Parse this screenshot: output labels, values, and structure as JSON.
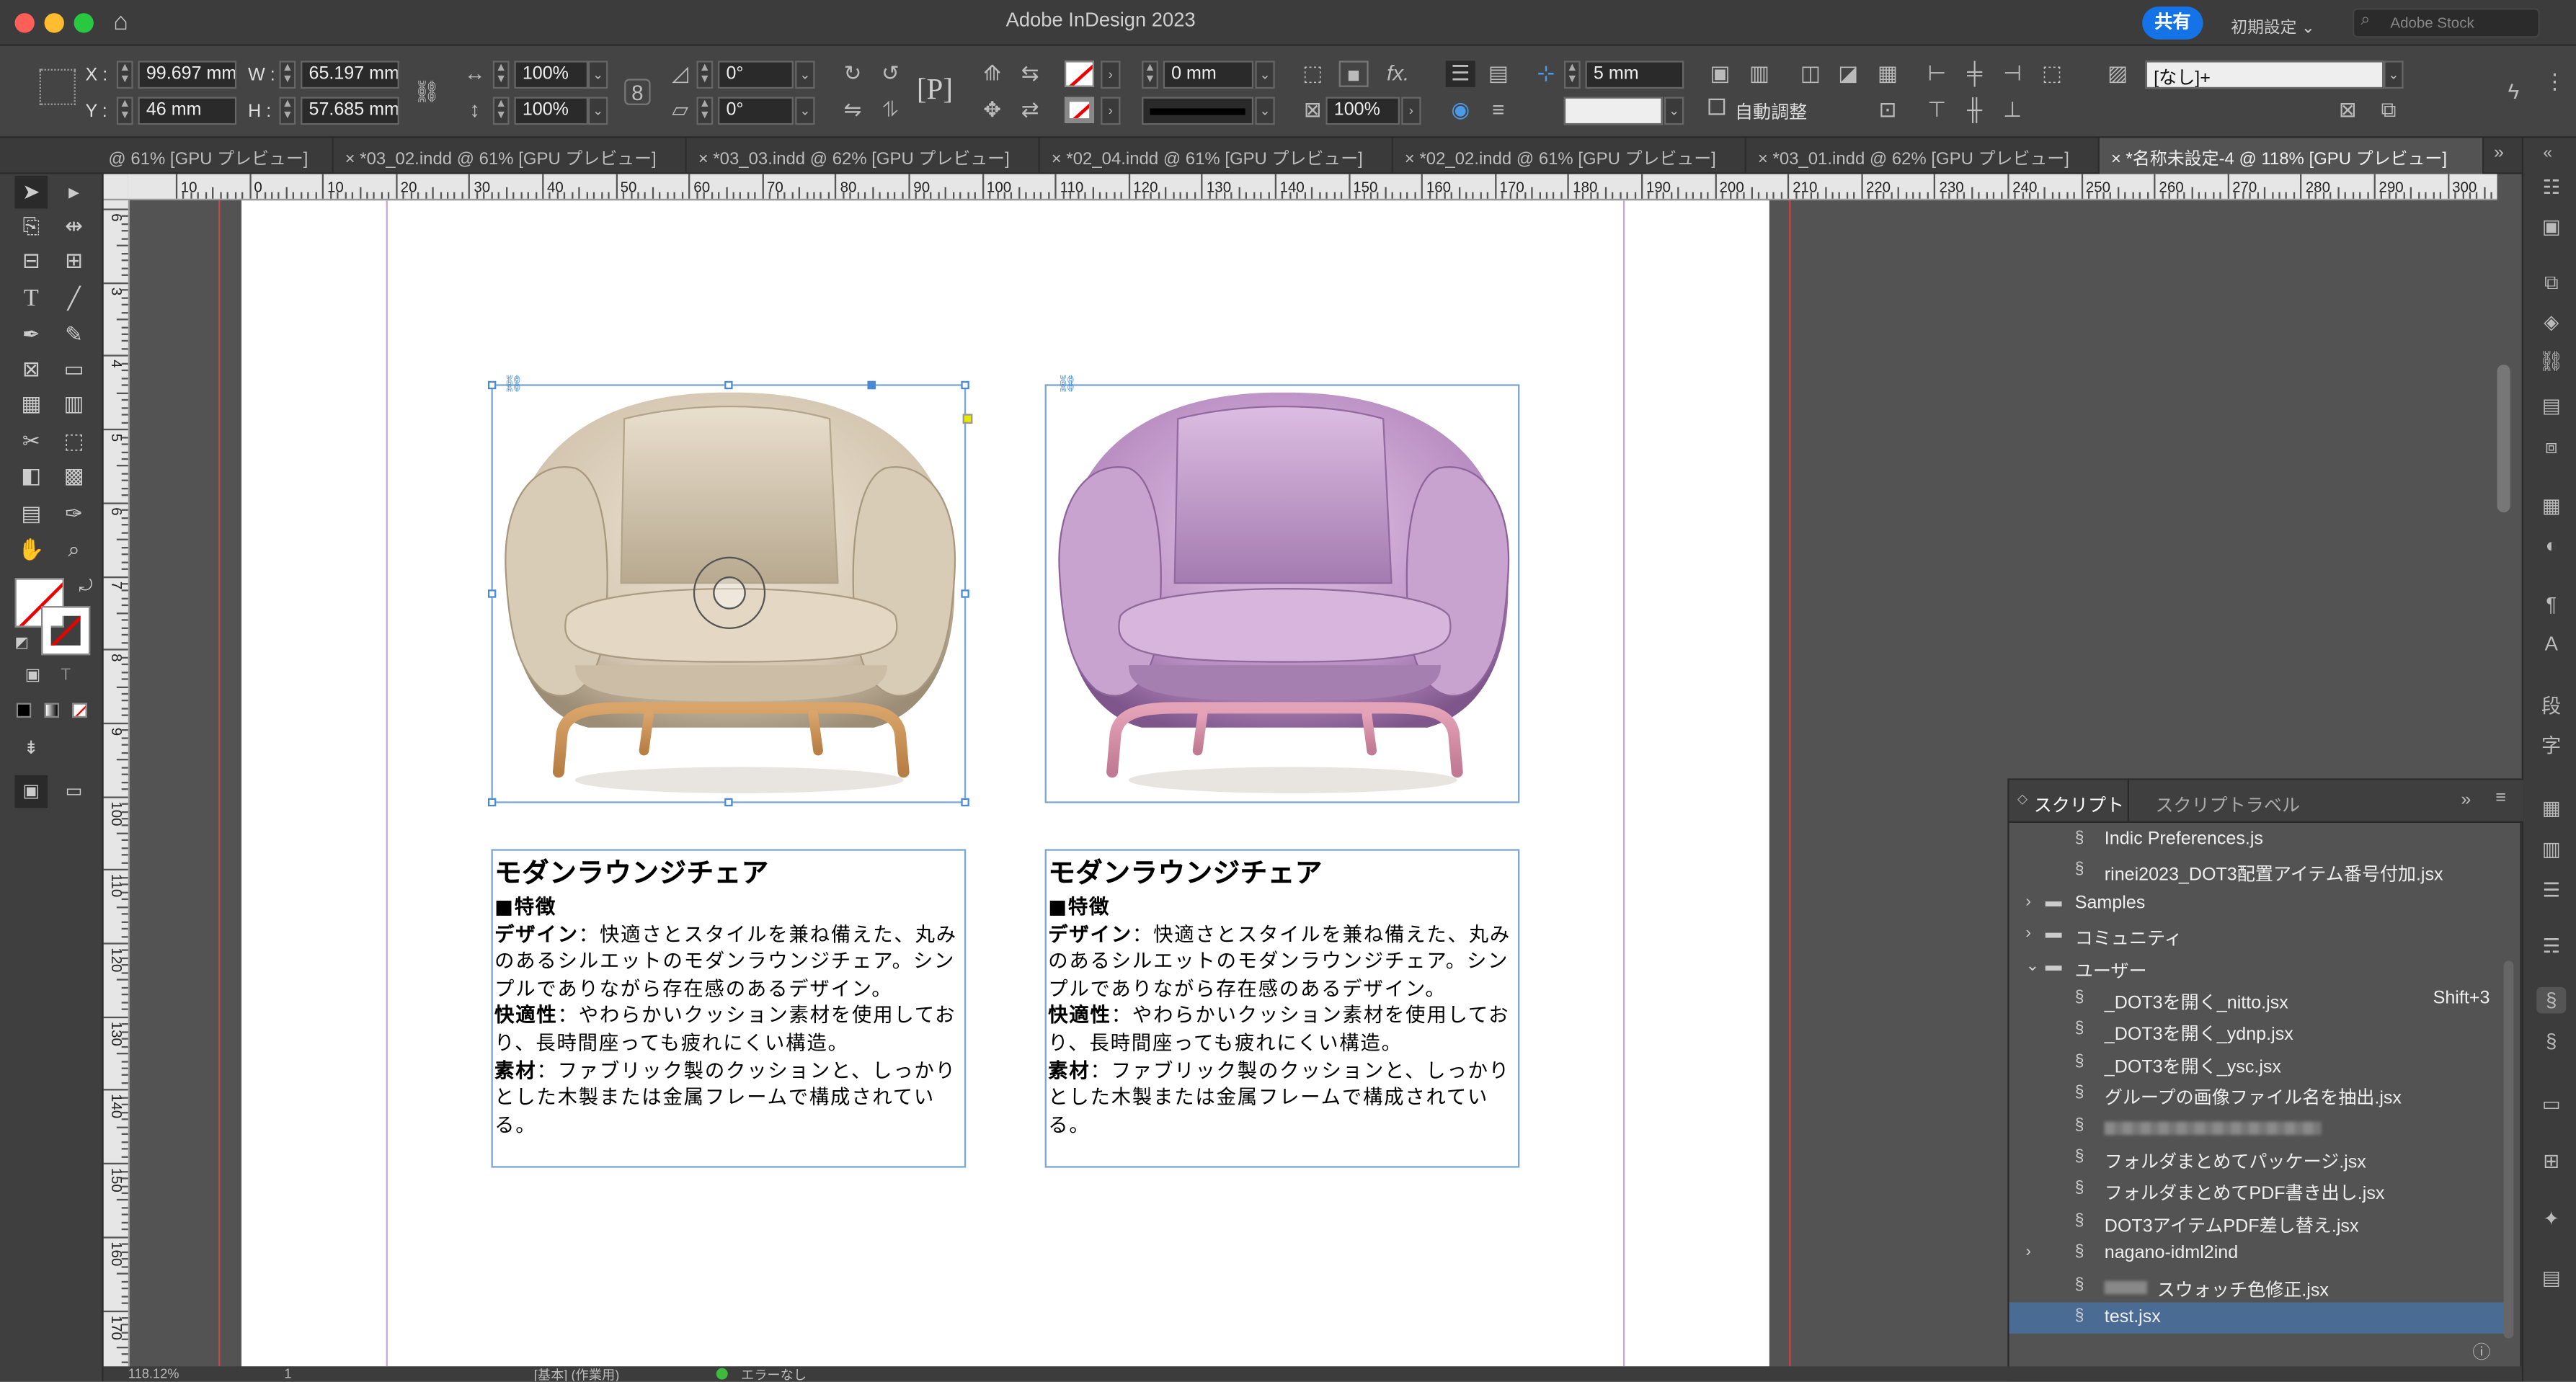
{
  "app": {
    "title": "Adobe InDesign 2023",
    "share_label": "共有",
    "workspace": "初期設定",
    "stock_placeholder": "Adobe Stock"
  },
  "control": {
    "x_label": "X :",
    "x": "99.697 mm",
    "y_label": "Y :",
    "y": "46 mm",
    "w_label": "W :",
    "w": "65.197 mm",
    "h_label": "H :",
    "h": "57.685 mm",
    "scale_x": "100%",
    "scale_y": "100%",
    "rotate": "0°",
    "shear": "0°",
    "stroke_weight": "0 mm",
    "opacity": "100%",
    "gap": "5 mm",
    "auto_fit": "自動調整",
    "object_style": "[なし]+"
  },
  "tabs": [
    {
      "label": "@ 61% [GPU プレビュー]"
    },
    {
      "label": "*03_02.indd @ 61% [GPU プレビュー]"
    },
    {
      "label": "*03_03.indd @ 62% [GPU プレビュー]"
    },
    {
      "label": "*02_04.indd @ 61% [GPU プレビュー]"
    },
    {
      "label": "*02_02.indd @ 61% [GPU プレビュー]"
    },
    {
      "label": "*03_01.indd @ 62% [GPU プレビュー]"
    },
    {
      "label": "*名称未設定-4 @ 118% [GPU プレビュー]"
    }
  ],
  "hruler": [
    "10",
    "0",
    "10",
    "20",
    "30",
    "40",
    "50",
    "60",
    "70",
    "80",
    "90",
    "100",
    "110",
    "120",
    "130",
    "140",
    "150",
    "160",
    "170",
    "180",
    "190",
    "200",
    "210",
    "220",
    "230",
    "240",
    "250",
    "260",
    "270",
    "280",
    "290",
    "300"
  ],
  "vruler": [
    "6",
    "3",
    "4",
    "5",
    "6",
    "7",
    "8",
    "9",
    "100",
    "110",
    "120",
    "130",
    "140",
    "150",
    "160",
    "170"
  ],
  "cards": [
    {
      "title": "モダンラウンジチェア",
      "feature": "■特徴",
      "design_label": "デザイン",
      "design_text": "：快適さとスタイルを兼ね備えた、丸みのあるシルエットのモダンラウンジチェア。シンプルでありながら存在感のあるデザイン。",
      "comfort_label": "快適性",
      "comfort_text": "：やわらかいクッション素材を使用しており、長時間座っても疲れにくい構造。",
      "material_label": "素材",
      "material_text": "：ファブリック製のクッションと、しっかりとした木製または金属フレームで構成されている。",
      "color": "beige"
    },
    {
      "title": "モダンラウンジチェア",
      "feature": "■特徴",
      "design_label": "デザイン",
      "design_text": "：快適さとスタイルを兼ね備えた、丸みのあるシルエットのモダンラウンジチェア。シンプルでありながら存在感のあるデザイン。",
      "comfort_label": "快適性",
      "comfort_text": "：やわらかいクッション素材を使用しており、長時間座っても疲れにくい構造。",
      "material_label": "素材",
      "material_text": "：ファブリック製のクッションと、しっかりとした木製または金属フレームで構成されている。",
      "color": "purple"
    }
  ],
  "scripts_panel": {
    "tab_scripts": "スクリプト",
    "tab_labels": "スクリプトラベル",
    "items": [
      {
        "label": "Indic Preferences.js",
        "type": "script"
      },
      {
        "label": "rinei2023_DOT3配置アイテム番号付加.jsx",
        "type": "script"
      },
      {
        "label": "Samples",
        "type": "folder"
      },
      {
        "label": "コミュニティ",
        "type": "folder"
      },
      {
        "label": "ユーザー",
        "type": "folder-open"
      },
      {
        "label": "_DOT3を開く_nitto.jsx",
        "type": "script",
        "shortcut": "Shift+3"
      },
      {
        "label": "_DOT3を開く_ydnp.jsx",
        "type": "script"
      },
      {
        "label": "_DOT3を開く_ysc.jsx",
        "type": "script"
      },
      {
        "label": "グループの画像ファイル名を抽出.jsx",
        "type": "script"
      },
      {
        "label": "",
        "type": "script-blurred"
      },
      {
        "label": "フォルダまとめてパッケージ.jsx",
        "type": "script"
      },
      {
        "label": "フォルダまとめてPDF書き出し.jsx",
        "type": "script"
      },
      {
        "label": "DOT3アイテムPDF差し替え.jsx",
        "type": "script"
      },
      {
        "label": "nagano-idml2ind",
        "type": "script-folder"
      },
      {
        "label": "スウォッチ色修正.jsx",
        "type": "script-partial"
      },
      {
        "label": "test.jsx",
        "type": "script-selected"
      }
    ]
  },
  "status": {
    "zoom": "118.12%",
    "page": "1",
    "preflight_profile": "[基本] (作業用)",
    "errors": "エラーなし"
  },
  "colors": {
    "accent": "#1473e6",
    "frame": "#79a6d2",
    "selection": "#4a6b94"
  }
}
